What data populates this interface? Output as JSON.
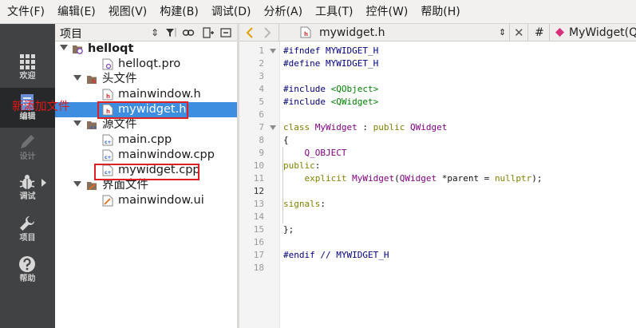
{
  "menu": [
    "文件(F)",
    "编辑(E)",
    "视图(V)",
    "构建(B)",
    "调试(D)",
    "分析(A)",
    "工具(T)",
    "控件(W)",
    "帮助(H)"
  ],
  "modes": [
    {
      "label": "欢迎",
      "icon": "grid-icon",
      "state": "normal"
    },
    {
      "label": "编辑",
      "icon": "document-icon",
      "state": "active"
    },
    {
      "label": "设计",
      "icon": "pencil-icon",
      "state": "disabled"
    },
    {
      "label": "调试",
      "icon": "bug-icon",
      "state": "normal"
    },
    {
      "label": "项目",
      "icon": "wrench-icon",
      "state": "normal"
    },
    {
      "label": "帮助",
      "icon": "help-icon",
      "state": "normal"
    }
  ],
  "project": {
    "title": "项目",
    "tree": [
      {
        "label": "helloqt",
        "kind": "project",
        "bold": true
      },
      {
        "label": "helloqt.pro",
        "kind": "pro"
      },
      {
        "label": "头文件",
        "kind": "folder-h"
      },
      {
        "label": "mainwindow.h",
        "kind": "header"
      },
      {
        "label": "mywidget.h",
        "kind": "header",
        "selected": true
      },
      {
        "label": "源文件",
        "kind": "folder-cpp"
      },
      {
        "label": "main.cpp",
        "kind": "source"
      },
      {
        "label": "mainwindow.cpp",
        "kind": "source"
      },
      {
        "label": "mywidget.cpp",
        "kind": "source"
      },
      {
        "label": "界面文件",
        "kind": "folder-ui"
      },
      {
        "label": "mainwindow.ui",
        "kind": "ui"
      }
    ],
    "annotation": "新添加文件"
  },
  "editor": {
    "filename": "mywidget.h",
    "symbol": "MyWidget(Q",
    "hash": "#",
    "current_line": 12,
    "lines": [
      "#ifndef MYWIDGET_H",
      "#define MYWIDGET_H",
      "",
      "#include <QObject>",
      "#include <QWidget>",
      "",
      "class MyWidget : public QWidget",
      "{",
      "    Q_OBJECT",
      "public:",
      "    explicit MyWidget(QWidget *parent = nullptr);",
      "",
      "signals:",
      "",
      "};",
      "",
      "#endif // MYWIDGET_H",
      ""
    ]
  },
  "colors": {
    "selection": "#3d8ee0",
    "annotation_red": "#e02020",
    "modebar": "#404244"
  }
}
